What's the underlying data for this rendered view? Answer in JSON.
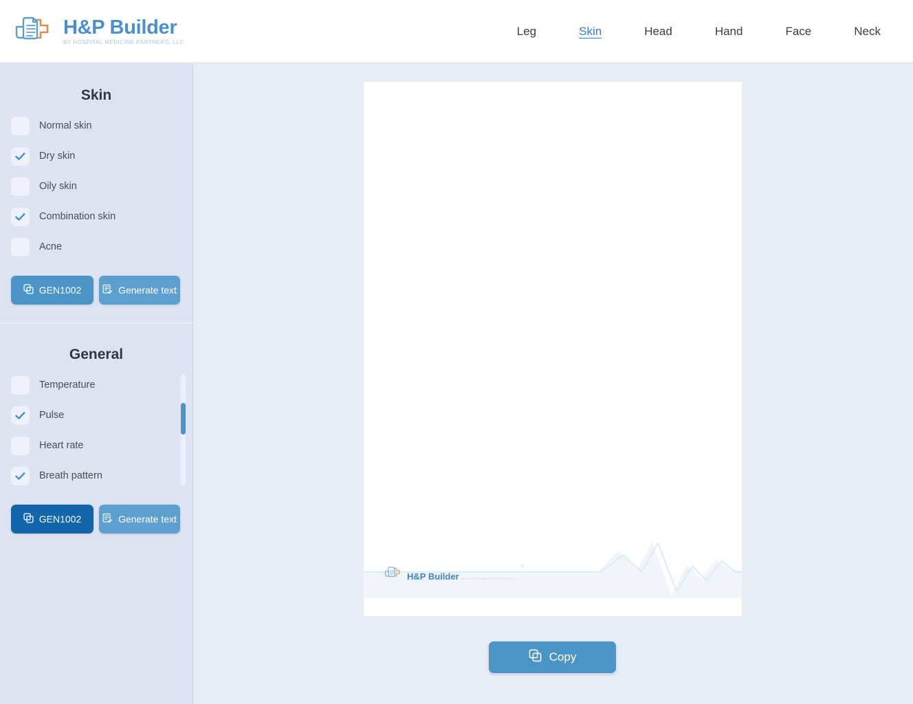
{
  "header": {
    "brand_title": "H&P Builder",
    "brand_subtitle": "BY HOSPITAL MEDICINE PARTNERS, LLC",
    "nav": [
      {
        "label": "Leg",
        "active": false
      },
      {
        "label": "Skin",
        "active": true
      },
      {
        "label": "Head",
        "active": false
      },
      {
        "label": "Hand",
        "active": false
      },
      {
        "label": "Face",
        "active": false
      },
      {
        "label": "Neck",
        "active": false
      }
    ]
  },
  "sidebar": {
    "close_label": "×",
    "panels": [
      {
        "title": "Skin",
        "options": [
          {
            "label": "Normal skin",
            "checked": false
          },
          {
            "label": "Dry skin",
            "checked": true
          },
          {
            "label": "Oily skin",
            "checked": false
          },
          {
            "label": "Combination skin",
            "checked": true
          },
          {
            "label": "Acne",
            "checked": false
          }
        ],
        "gen_label": "GEN1002",
        "generate_label": "Generate text",
        "gen_pressed": false
      },
      {
        "title": "General",
        "options": [
          {
            "label": "Temperature",
            "checked": false
          },
          {
            "label": "Pulse",
            "checked": true
          },
          {
            "label": "Heart rate",
            "checked": false
          },
          {
            "label": "Breath pattern",
            "checked": true
          }
        ],
        "gen_label": "GEN1002",
        "generate_label": "Generate text",
        "gen_pressed": true
      }
    ]
  },
  "main": {
    "document_text": "",
    "watermark": {
      "title": "H&P Builder",
      "registered": "®",
      "subtitle": "BY HOSPITAL MEDICINE PARTNERS, LLC"
    },
    "copy_label": "Copy"
  },
  "colors": {
    "accent_blue": "#4a94c6",
    "accent_blue_pressed": "#1266a9",
    "brand_blue": "#4a90cc",
    "brand_orange": "#e08a4e",
    "sidebar_bg": "#dde3f1",
    "main_bg": "#e8ecf5",
    "link_blue": "#2a7fd4"
  }
}
